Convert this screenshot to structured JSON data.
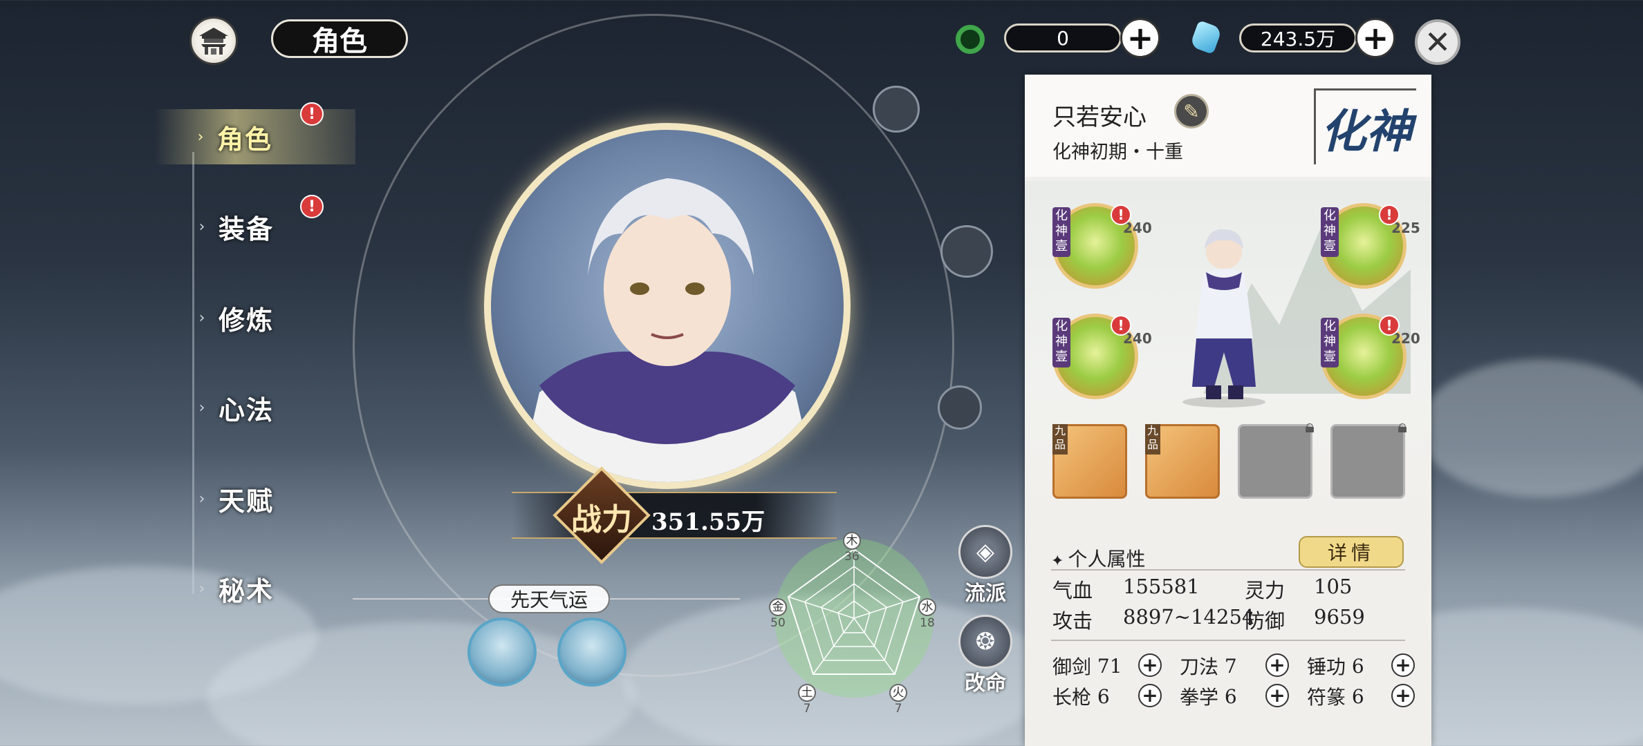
{
  "header": {
    "title": "角色",
    "resource_1": {
      "icon": "jade-ring-icon",
      "value": "0"
    },
    "resource_2": {
      "icon": "spirit-stone-icon",
      "value": "243.5万"
    }
  },
  "nav": {
    "items": [
      {
        "label": "角色",
        "active": true,
        "alert": true
      },
      {
        "label": "装备",
        "active": false,
        "alert": true
      },
      {
        "label": "修炼",
        "active": false,
        "alert": false
      },
      {
        "label": "心法",
        "active": false,
        "alert": false
      },
      {
        "label": "天赋",
        "active": false,
        "alert": false
      },
      {
        "label": "秘术",
        "active": false,
        "alert": false
      }
    ],
    "alert_symbol": "!"
  },
  "hero": {
    "power_label": "战力",
    "power_value": "351.55万",
    "luck_label": "先天气运"
  },
  "elements": {
    "wood": {
      "char": "木",
      "value": "36"
    },
    "water": {
      "char": "水",
      "value": "18"
    },
    "fire": {
      "char": "火",
      "value": "7"
    },
    "earth": {
      "char": "土",
      "value": "7"
    },
    "metal": {
      "char": "金",
      "value": "50"
    }
  },
  "actions": {
    "school": "流派",
    "fate": "改命"
  },
  "panel": {
    "name": "只若安心",
    "realm": "化神初期・十重",
    "realm_emblem": "化神",
    "orbs": [
      {
        "tag": "化神壹",
        "level": "240"
      },
      {
        "tag": "化神壹",
        "level": "225"
      },
      {
        "tag": "化神壹",
        "level": "240"
      },
      {
        "tag": "化神壹",
        "level": "220"
      }
    ],
    "slots": [
      {
        "tag": "九品",
        "state": "filled"
      },
      {
        "tag": "九品",
        "state": "filled"
      },
      {
        "tag": "",
        "state": "locked"
      },
      {
        "tag": "",
        "state": "locked"
      }
    ],
    "attributes_title": "个人属性",
    "detail_button": "详情",
    "stats": {
      "hp_label": "气血",
      "hp_value": "155581",
      "sp_label": "灵力",
      "sp_value": "105",
      "atk_label": "攻击",
      "atk_value": "8897~14254",
      "def_label": "防御",
      "def_value": "9659"
    },
    "skills": [
      {
        "label": "御剑",
        "value": "71"
      },
      {
        "label": "刀法",
        "value": "7"
      },
      {
        "label": "锤功",
        "value": "6"
      },
      {
        "label": "长枪",
        "value": "6"
      },
      {
        "label": "拳学",
        "value": "6"
      },
      {
        "label": "符篆",
        "value": "6"
      }
    ]
  }
}
